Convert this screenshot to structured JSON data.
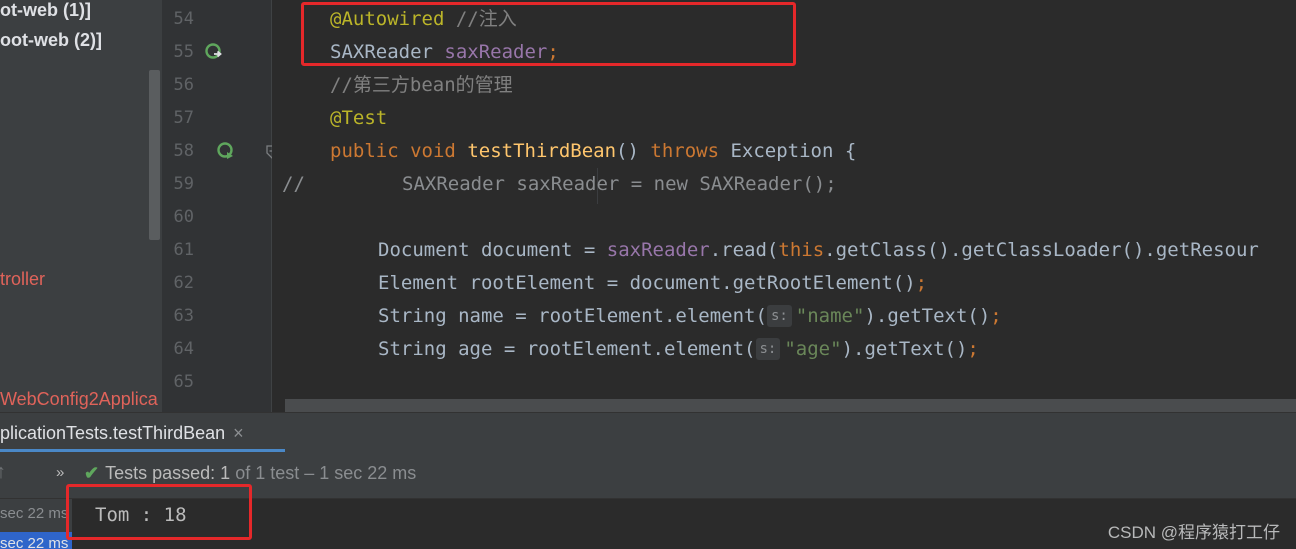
{
  "project_tree": {
    "items": [
      {
        "label": "ot-web (1)]",
        "style": "bold"
      },
      {
        "label": "oot-web (2)]",
        "style": "bold"
      },
      {
        "label": "troller",
        "style": "error"
      },
      {
        "label": "WebConfig2Applica",
        "style": "error"
      }
    ]
  },
  "editor": {
    "line_numbers": [
      "54",
      "55",
      "56",
      "57",
      "58",
      "59",
      "60",
      "61",
      "62",
      "63",
      "64",
      "65"
    ],
    "lines": {
      "l54": {
        "annotation": "@Autowired",
        "comment": "//注入"
      },
      "l55": {
        "type": "SAXReader",
        "field": "saxReader",
        "semi": ";"
      },
      "l56": {
        "comment": "//第三方bean的管理"
      },
      "l57": {
        "annotation": "@Test"
      },
      "l58": {
        "kw_public": "public",
        "kw_void": "void",
        "method": "testThirdBean",
        "paren": "()",
        "kw_throws": "throws",
        "exc": "Exception {"
      },
      "l59": {
        "prefix": "//",
        "code": "SAXReader saxReader = new SAXReader();"
      },
      "l61": {
        "a": "Document document = ",
        "field": "saxReader",
        "b": ".read(",
        "kw_this": "this",
        "c": ".getClass().getClassLoader().getResour"
      },
      "l62": {
        "a": "Element rootElement = document.getRootElement()",
        "semi": ";"
      },
      "l63": {
        "a": "String name = rootElement.element(",
        "hint": "s:",
        "str": "\"name\"",
        "b": ").getText()",
        "semi": ";"
      },
      "l64": {
        "a": "String age = rootElement.element(",
        "hint": "s:",
        "str": "\"age\"",
        "b": ").getText()",
        "semi": ";"
      }
    }
  },
  "run_panel": {
    "tab_label": "plicationTests.testThirdBean",
    "close_glyph": "×",
    "chevron": "»",
    "status_passed": "Tests passed:",
    "status_count": "1",
    "status_rest": "of 1 test – 1 sec 22 ms",
    "left_rows": [
      "sec 22 ms",
      "sec 22 ms"
    ],
    "console_output": "Tom : 18"
  },
  "watermark": "CSDN @程序猿打工仔",
  "colors": {
    "keyword": "#cc7832",
    "annotation": "#bbb529",
    "field": "#9876aa",
    "method": "#ffc66d",
    "string": "#6a8759",
    "comment": "#808080",
    "highlight_box": "#e5282a",
    "pass_green": "#5fa75d",
    "selection": "#2f65ca"
  },
  "icons": {
    "gutter_55": "run-field-icon",
    "gutter_58": "run-test-icon",
    "fold": "fold-marker-icon",
    "pass": "check-icon",
    "arrow": "up-arrow-icon"
  }
}
